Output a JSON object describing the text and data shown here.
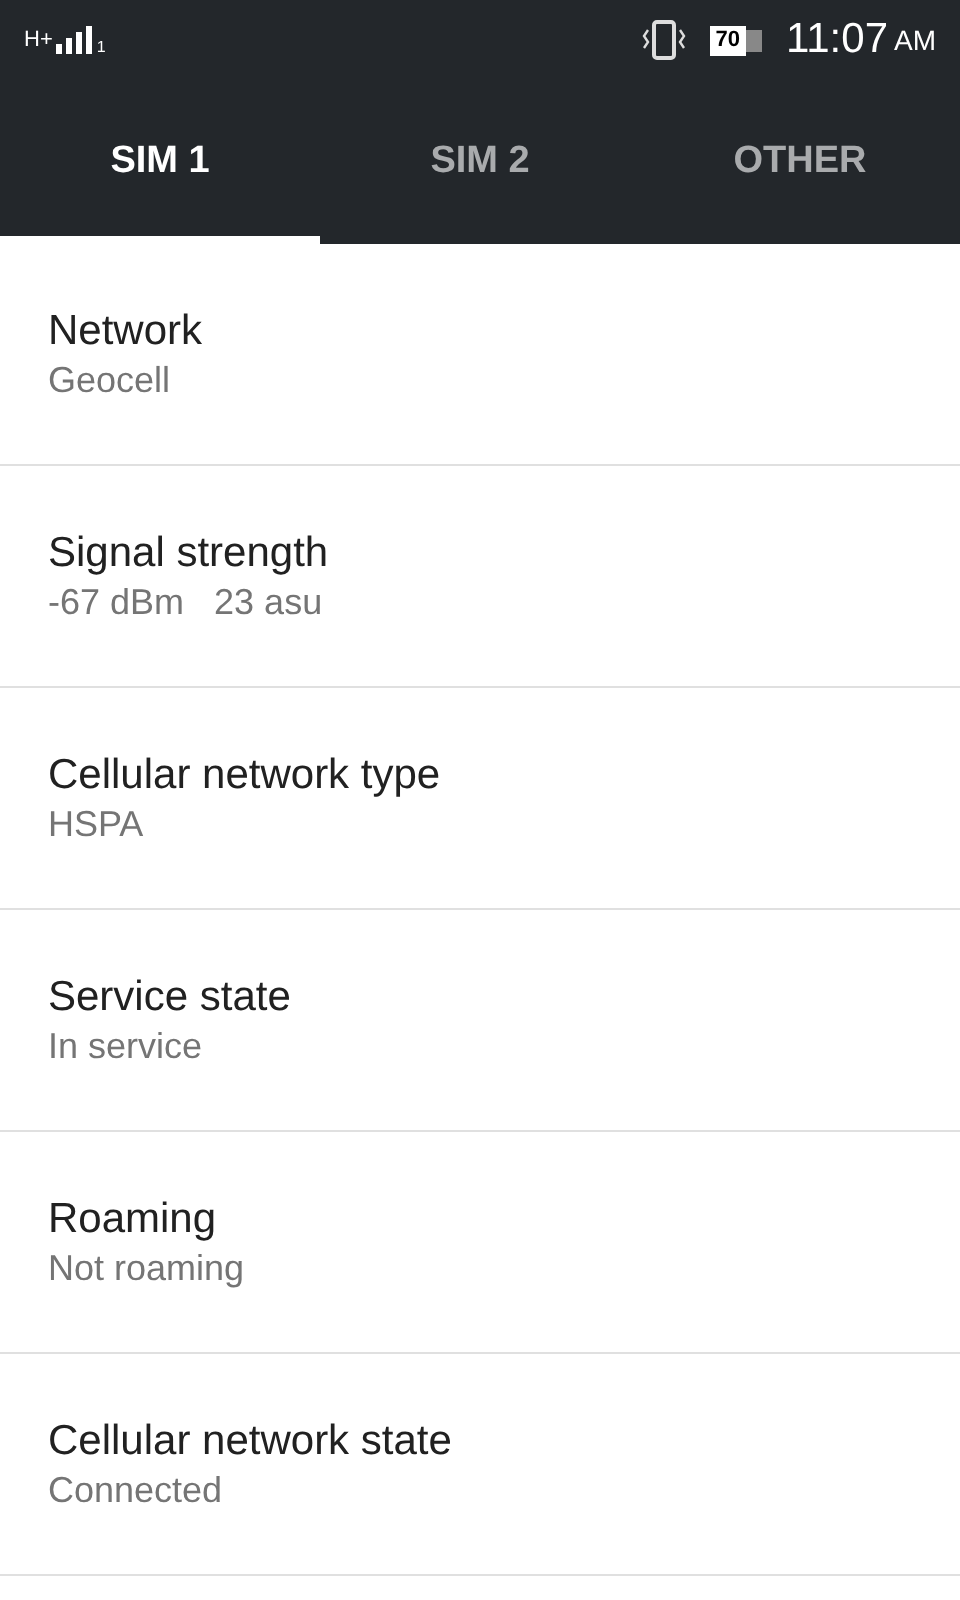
{
  "status_bar": {
    "network_type": "H+",
    "sim_number": "1",
    "battery": "70",
    "time": "11:07",
    "meridiem": "AM"
  },
  "tabs": [
    {
      "label": "SIM 1",
      "selected": true
    },
    {
      "label": "SIM 2",
      "selected": false
    },
    {
      "label": "OTHER",
      "selected": false
    }
  ],
  "items": [
    {
      "title": "Network",
      "value": "Geocell"
    },
    {
      "title": "Signal strength",
      "value": "-67 dBm   23 asu"
    },
    {
      "title": "Cellular network type",
      "value": "HSPA"
    },
    {
      "title": "Service state",
      "value": "In service"
    },
    {
      "title": "Roaming",
      "value": "Not roaming"
    },
    {
      "title": "Cellular network state",
      "value": "Connected"
    }
  ]
}
